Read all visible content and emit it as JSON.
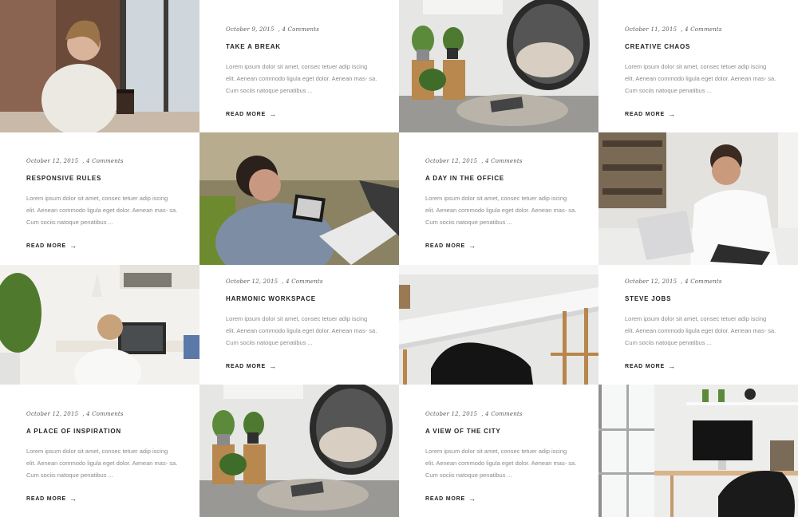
{
  "cards": [
    {
      "date": "October 9, 2015",
      "comments": "4 Comments",
      "title": "TAKE A BREAK",
      "excerpt": "Lorem ipsum dolor sit amet, consec tetuer adip iscing elit. Aenean commodo ligula eget dolor. Aenean mas- sa. Cum sociis natoque penatibus ...",
      "more": "READ MORE",
      "arrow": "→"
    },
    {
      "date": "October 11, 2015",
      "comments": "4 Comments",
      "title": "CREATIVE CHAOS",
      "excerpt": "Lorem ipsum dolor sit amet, consec tetuer adip iscing elit. Aenean commodo ligula eget dolor. Aenean mas- sa. Cum sociis natoque penatibus ...",
      "more": "READ MORE",
      "arrow": "→"
    },
    {
      "date": "October 12, 2015",
      "comments": "4 Comments",
      "title": "RESPONSIVE RULES",
      "excerpt": "Lorem ipsum dolor sit amet, consec tetuer adip iscing elit. Aenean commodo ligula eget dolor. Aenean mas- sa. Cum sociis natoque penatibus ...",
      "more": "READ MORE",
      "arrow": "→"
    },
    {
      "date": "October 12, 2015",
      "comments": "4 Comments",
      "title": "A DAY IN THE OFFICE",
      "excerpt": "Lorem ipsum dolor sit amet, consec tetuer adip iscing elit. Aenean commodo ligula eget dolor. Aenean mas- sa. Cum sociis natoque penatibus ...",
      "more": "READ MORE",
      "arrow": "→"
    },
    {
      "date": "October 12, 2015",
      "comments": "4 Comments",
      "title": "HARMONIC WORKSPACE",
      "excerpt": "Lorem ipsum dolor sit amet, consec tetuer adip iscing elit. Aenean commodo ligula eget dolor. Aenean mas- sa. Cum sociis natoque penatibus ...",
      "more": "READ MORE",
      "arrow": "→"
    },
    {
      "date": "October 12, 2015",
      "comments": "4 Comments",
      "title": "STEVE JOBS",
      "excerpt": "Lorem ipsum dolor sit amet, consec tetuer adip iscing elit. Aenean commodo ligula eget dolor. Aenean mas- sa. Cum sociis natoque penatibus ...",
      "more": "READ MORE",
      "arrow": "→"
    },
    {
      "date": "October 12, 2015",
      "comments": "4 Comments",
      "title": "A PLACE OF INSPIRATION",
      "excerpt": "Lorem ipsum dolor sit amet, consec tetuer adip iscing elit. Aenean commodo ligula eget dolor. Aenean mas- sa. Cum sociis natoque penatibus ...",
      "more": "READ MORE",
      "arrow": "→"
    },
    {
      "date": "October 12, 2015",
      "comments": "4 Comments",
      "title": "A VIEW OF THE CITY",
      "excerpt": "Lorem ipsum dolor sit amet, consec tetuer adip iscing elit. Aenean commodo ligula eget dolor. Aenean mas- sa. Cum sociis natoque penatibus ...",
      "more": "READ MORE",
      "arrow": "→"
    }
  ],
  "colors": {
    "text": "#222222",
    "muted": "#8a8a8a",
    "meta": "#5a5a5a",
    "background": "#ffffff"
  }
}
